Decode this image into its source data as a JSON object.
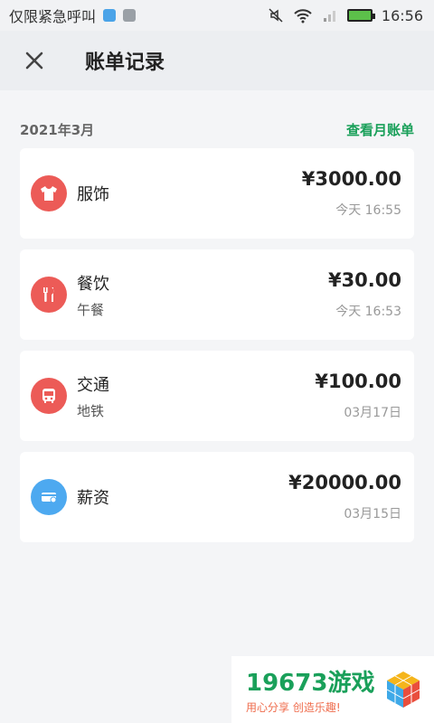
{
  "status_bar": {
    "left_text": "仅限紧急呼叫",
    "time": "16:56"
  },
  "header": {
    "title": "账单记录"
  },
  "month": {
    "label": "2021年3月",
    "link": "查看月账单"
  },
  "records": [
    {
      "name": "服饰",
      "note": "",
      "amount": "¥3000.00",
      "time": "今天 16:55",
      "icon": "shirt-icon",
      "color": "#ec5b57"
    },
    {
      "name": "餐饮",
      "note": "午餐",
      "amount": "¥30.00",
      "time": "今天 16:53",
      "icon": "fork-knife-icon",
      "color": "#ec5b57"
    },
    {
      "name": "交通",
      "note": "地铁",
      "amount": "¥100.00",
      "time": "03月17日",
      "icon": "bus-icon",
      "color": "#ec5b57"
    },
    {
      "name": "薪资",
      "note": "",
      "amount": "¥20000.00",
      "time": "03月15日",
      "icon": "wallet-icon",
      "color": "#4da9f0"
    }
  ],
  "watermark": {
    "main": "19673游戏",
    "sub": "用心分享 创造乐趣!"
  }
}
